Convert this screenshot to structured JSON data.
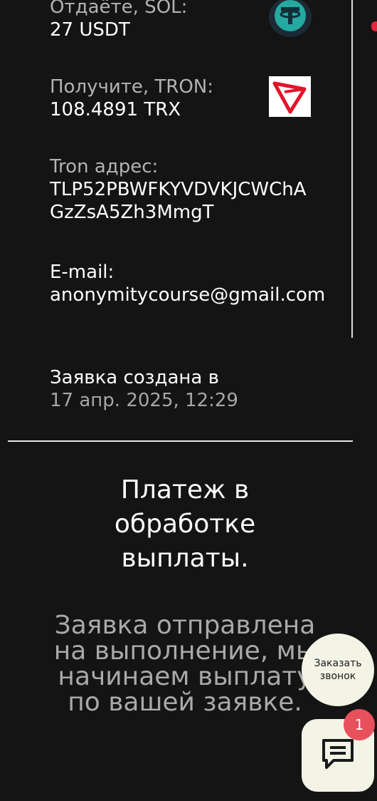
{
  "order": {
    "give": {
      "label": "Отдаёте, SOL:",
      "value": "27 USDT",
      "icon": "usdt-icon"
    },
    "get": {
      "label": "Получите, TRON:",
      "value": "108.4891 TRX",
      "icon": "tron-icon"
    },
    "address": {
      "label": "Tron адрес:",
      "value": "TLP52PBWFKYVDVKJCWChAGzZsA5Zh3MmgT"
    },
    "email": {
      "label": "E-mail:",
      "value": "anonymitycourse@gmail.com"
    },
    "created": {
      "label": "Заявка создана в",
      "value": "17 апр. 2025, 12:29"
    }
  },
  "status": {
    "title": "Платеж в обработке выплаты.",
    "description": "Заявка отправлена на выполнение, мы начинаем выплату по вашей заявке."
  },
  "widgets": {
    "call_button_label": "Заказать звонок",
    "chat_badge_count": "1",
    "chat_icon": "chat-icon"
  },
  "colors": {
    "background": "#141414",
    "tron_red": "#e3142a",
    "usdt_teal": "#26a17b",
    "badge": "#e8505b",
    "widget_bg": "#f3f3e6"
  }
}
